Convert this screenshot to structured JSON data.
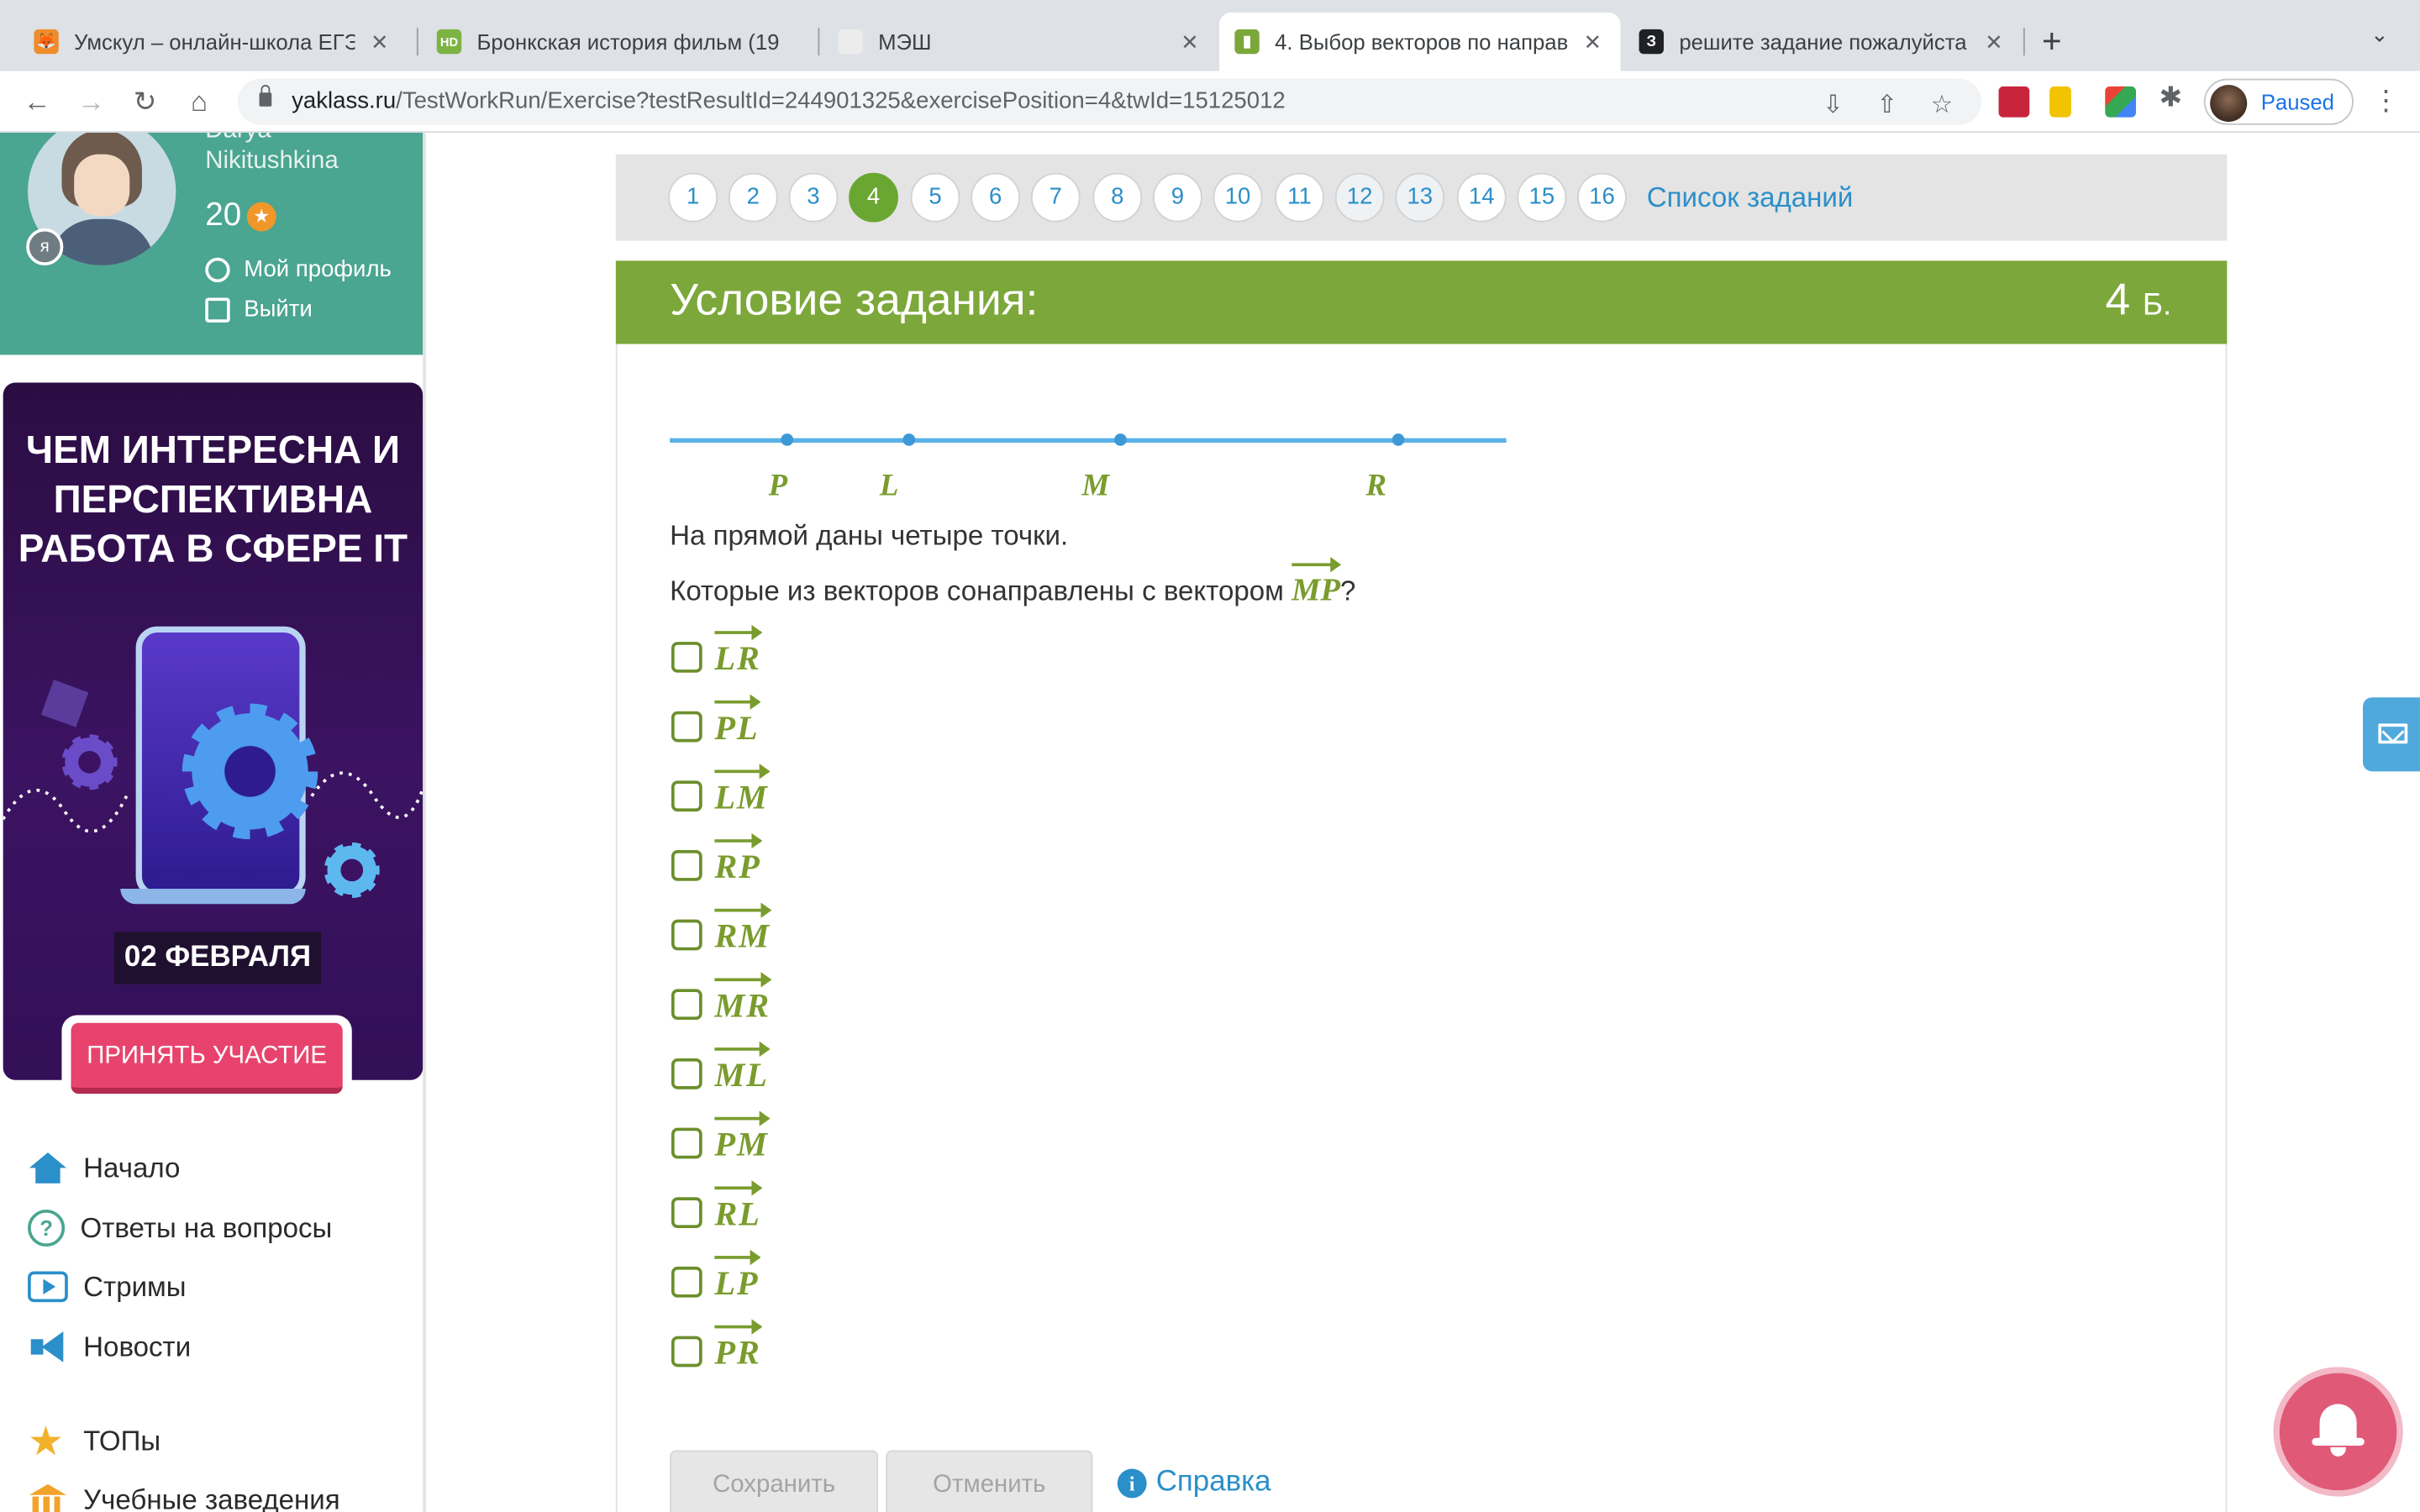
{
  "browser": {
    "tabs": [
      {
        "title": "Умскул – онлайн-школа ЕГЭ и",
        "active": false
      },
      {
        "title": "Бронкская история фильм (19",
        "active": false
      },
      {
        "title": "МЭШ",
        "active": false
      },
      {
        "title": "4. Выбор векторов по направ",
        "active": true
      },
      {
        "title": "решите задание пожалуйста",
        "active": false
      }
    ],
    "url_host": "yaklass.ru",
    "url_path": "/TestWorkRun/Exercise?testResultId=244901325&exercisePosition=4&twId=15125012",
    "profile_label": "Paused"
  },
  "user": {
    "first_name": "Darya",
    "last_name": "Nikitushkina",
    "points": "20",
    "profile_link": "Мой профиль",
    "logout_link": "Выйти"
  },
  "banner": {
    "title": "Чем интересна и перспективна работа в сфере IT",
    "date": "02 ФЕВРАЛЯ",
    "cta": "ПРИНЯТЬ УЧАСТИЕ"
  },
  "menu": [
    {
      "label": "Начало",
      "icon": "home-icon"
    },
    {
      "label": "Ответы на вопросы",
      "icon": "question-icon"
    },
    {
      "label": "Стримы",
      "icon": "play-icon"
    },
    {
      "label": "Новости",
      "icon": "megaphone-icon"
    },
    {
      "label": "ТОПы",
      "icon": "star-icon"
    },
    {
      "label": "Учебные заведения",
      "icon": "institution-icon"
    }
  ],
  "question_nav": {
    "numbers": [
      "1",
      "2",
      "3",
      "4",
      "5",
      "6",
      "7",
      "8",
      "9",
      "10",
      "11",
      "12",
      "13",
      "14",
      "15",
      "16"
    ],
    "current": "4",
    "task_list_label": "Список заданий"
  },
  "task": {
    "header": "Условие задания:",
    "score_value": "4",
    "score_unit": "Б.",
    "points_on_line": [
      "P",
      "L",
      "M",
      "R"
    ],
    "text_line1": "На прямой даны четыре точки.",
    "text_line2": "Которые из векторов сонаправлены с вектором",
    "target_vector": "MP",
    "text_suffix": "?",
    "options": [
      "LR",
      "PL",
      "LM",
      "RP",
      "RM",
      "MR",
      "ML",
      "PM",
      "RL",
      "LP",
      "PR"
    ]
  },
  "actions": {
    "save": "Сохранить",
    "cancel": "Отменить",
    "help": "Справка"
  },
  "colors": {
    "accent_green": "#7ca73a",
    "link_blue": "#2b8fc9",
    "sidebar_teal": "#4aa591",
    "cta_pink": "#e8436d"
  }
}
